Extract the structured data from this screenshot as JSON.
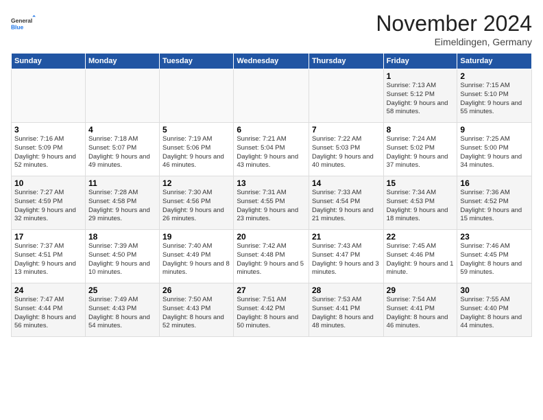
{
  "logo": {
    "general": "General",
    "blue": "Blue"
  },
  "title": "November 2024",
  "subtitle": "Eimeldingen, Germany",
  "days": [
    "Sunday",
    "Monday",
    "Tuesday",
    "Wednesday",
    "Thursday",
    "Friday",
    "Saturday"
  ],
  "weeks": [
    [
      {
        "day": "",
        "info": ""
      },
      {
        "day": "",
        "info": ""
      },
      {
        "day": "",
        "info": ""
      },
      {
        "day": "",
        "info": ""
      },
      {
        "day": "",
        "info": ""
      },
      {
        "day": "1",
        "info": "Sunrise: 7:13 AM\nSunset: 5:12 PM\nDaylight: 9 hours and 58 minutes."
      },
      {
        "day": "2",
        "info": "Sunrise: 7:15 AM\nSunset: 5:10 PM\nDaylight: 9 hours and 55 minutes."
      }
    ],
    [
      {
        "day": "3",
        "info": "Sunrise: 7:16 AM\nSunset: 5:09 PM\nDaylight: 9 hours and 52 minutes."
      },
      {
        "day": "4",
        "info": "Sunrise: 7:18 AM\nSunset: 5:07 PM\nDaylight: 9 hours and 49 minutes."
      },
      {
        "day": "5",
        "info": "Sunrise: 7:19 AM\nSunset: 5:06 PM\nDaylight: 9 hours and 46 minutes."
      },
      {
        "day": "6",
        "info": "Sunrise: 7:21 AM\nSunset: 5:04 PM\nDaylight: 9 hours and 43 minutes."
      },
      {
        "day": "7",
        "info": "Sunrise: 7:22 AM\nSunset: 5:03 PM\nDaylight: 9 hours and 40 minutes."
      },
      {
        "day": "8",
        "info": "Sunrise: 7:24 AM\nSunset: 5:02 PM\nDaylight: 9 hours and 37 minutes."
      },
      {
        "day": "9",
        "info": "Sunrise: 7:25 AM\nSunset: 5:00 PM\nDaylight: 9 hours and 34 minutes."
      }
    ],
    [
      {
        "day": "10",
        "info": "Sunrise: 7:27 AM\nSunset: 4:59 PM\nDaylight: 9 hours and 32 minutes."
      },
      {
        "day": "11",
        "info": "Sunrise: 7:28 AM\nSunset: 4:58 PM\nDaylight: 9 hours and 29 minutes."
      },
      {
        "day": "12",
        "info": "Sunrise: 7:30 AM\nSunset: 4:56 PM\nDaylight: 9 hours and 26 minutes."
      },
      {
        "day": "13",
        "info": "Sunrise: 7:31 AM\nSunset: 4:55 PM\nDaylight: 9 hours and 23 minutes."
      },
      {
        "day": "14",
        "info": "Sunrise: 7:33 AM\nSunset: 4:54 PM\nDaylight: 9 hours and 21 minutes."
      },
      {
        "day": "15",
        "info": "Sunrise: 7:34 AM\nSunset: 4:53 PM\nDaylight: 9 hours and 18 minutes."
      },
      {
        "day": "16",
        "info": "Sunrise: 7:36 AM\nSunset: 4:52 PM\nDaylight: 9 hours and 15 minutes."
      }
    ],
    [
      {
        "day": "17",
        "info": "Sunrise: 7:37 AM\nSunset: 4:51 PM\nDaylight: 9 hours and 13 minutes."
      },
      {
        "day": "18",
        "info": "Sunrise: 7:39 AM\nSunset: 4:50 PM\nDaylight: 9 hours and 10 minutes."
      },
      {
        "day": "19",
        "info": "Sunrise: 7:40 AM\nSunset: 4:49 PM\nDaylight: 9 hours and 8 minutes."
      },
      {
        "day": "20",
        "info": "Sunrise: 7:42 AM\nSunset: 4:48 PM\nDaylight: 9 hours and 5 minutes."
      },
      {
        "day": "21",
        "info": "Sunrise: 7:43 AM\nSunset: 4:47 PM\nDaylight: 9 hours and 3 minutes."
      },
      {
        "day": "22",
        "info": "Sunrise: 7:45 AM\nSunset: 4:46 PM\nDaylight: 9 hours and 1 minute."
      },
      {
        "day": "23",
        "info": "Sunrise: 7:46 AM\nSunset: 4:45 PM\nDaylight: 8 hours and 59 minutes."
      }
    ],
    [
      {
        "day": "24",
        "info": "Sunrise: 7:47 AM\nSunset: 4:44 PM\nDaylight: 8 hours and 56 minutes."
      },
      {
        "day": "25",
        "info": "Sunrise: 7:49 AM\nSunset: 4:43 PM\nDaylight: 8 hours and 54 minutes."
      },
      {
        "day": "26",
        "info": "Sunrise: 7:50 AM\nSunset: 4:43 PM\nDaylight: 8 hours and 52 minutes."
      },
      {
        "day": "27",
        "info": "Sunrise: 7:51 AM\nSunset: 4:42 PM\nDaylight: 8 hours and 50 minutes."
      },
      {
        "day": "28",
        "info": "Sunrise: 7:53 AM\nSunset: 4:41 PM\nDaylight: 8 hours and 48 minutes."
      },
      {
        "day": "29",
        "info": "Sunrise: 7:54 AM\nSunset: 4:41 PM\nDaylight: 8 hours and 46 minutes."
      },
      {
        "day": "30",
        "info": "Sunrise: 7:55 AM\nSunset: 4:40 PM\nDaylight: 8 hours and 44 minutes."
      }
    ]
  ]
}
